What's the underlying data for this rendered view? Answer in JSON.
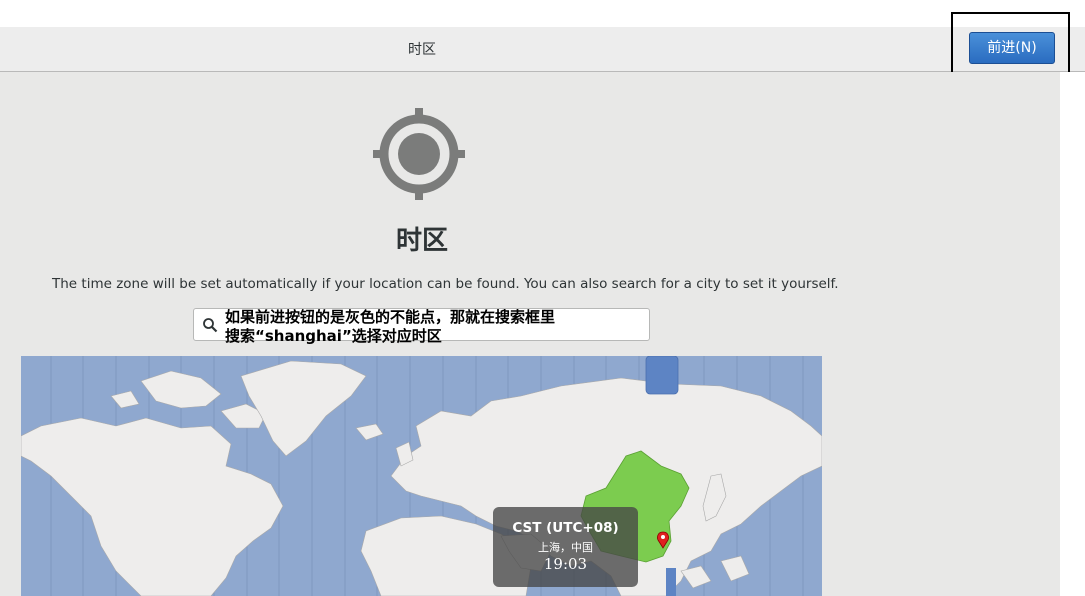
{
  "header": {
    "title": "时区",
    "next_button": "前进(N)"
  },
  "page": {
    "heading": "时区",
    "description": "The time zone will be set automatically if your location can be found. You can also search for a city to set it yourself."
  },
  "search": {
    "line1": "如果前进按钮的是灰色的不能点，那就在搜索框里",
    "line2": "搜索“shanghai”选择对应时区"
  },
  "map": {
    "tooltip": {
      "abbr": "CST (UTC+08)",
      "city": "上海，中国",
      "time": "19:03"
    }
  },
  "colors": {
    "accent": "#3a7fd2",
    "ocean": "#8fa8cf",
    "land": "#eeedec",
    "selected_zone": "#7ccc4f",
    "marker": "#e02020"
  }
}
